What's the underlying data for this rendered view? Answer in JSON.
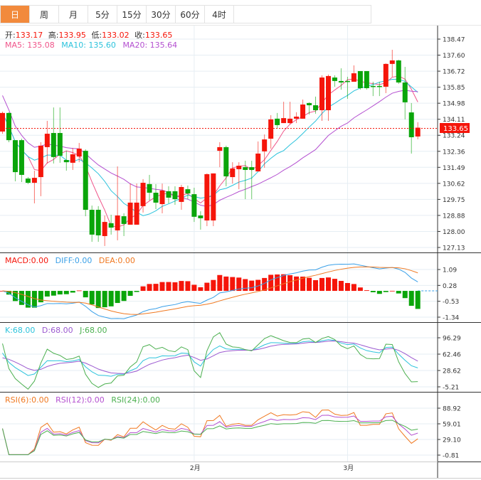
{
  "tabs": [
    {
      "label": "日",
      "active": true
    },
    {
      "label": "周"
    },
    {
      "label": "月"
    },
    {
      "label": "5分"
    },
    {
      "label": "15分"
    },
    {
      "label": "30分"
    },
    {
      "label": "60分"
    },
    {
      "label": "4时"
    }
  ],
  "ohlc_header": {
    "open_label": "开:",
    "open": "133.17",
    "high_label": "高:",
    "high": "133.95",
    "low_label": "低:",
    "low": "133.02",
    "close_label": "收:",
    "close": "133.65"
  },
  "ma_legend": {
    "ma5": "MA5: 135.08",
    "ma10": "MA10: 135.60",
    "ma20": "MA20: 135.64"
  },
  "macd_legend": {
    "macd": "MACD:0.00",
    "diff": "DIFF:0.00",
    "dea": "DEA:0.00"
  },
  "kdj_legend": {
    "k": "K:68.00",
    "d": "D:68.00",
    "j": "J:68.00"
  },
  "rsi_legend": {
    "rsi6": "RSI(6):0.00",
    "rsi12": "RSI(12):0.00",
    "rsi24": "RSI(24):0.00"
  },
  "current_price": "133.65",
  "x_labels": [
    "2月",
    "3月"
  ],
  "colors": {
    "up": "#f5150a",
    "down": "#0aa50a",
    "ma5": "#f0558a",
    "ma10": "#2cc3dc",
    "ma20": "#b450d0",
    "dea": "#f07820",
    "diff": "#3aa0e8",
    "active_tab": "#f28a3c"
  },
  "chart_data": {
    "type": "candlestick",
    "price_axis_ticks": [
      "138.47",
      "137.60",
      "136.72",
      "135.85",
      "134.98",
      "134.11",
      "133.24",
      "132.36",
      "131.49",
      "130.62",
      "129.75",
      "128.88",
      "128.00",
      "127.13"
    ],
    "price_range": [
      127.13,
      138.47
    ],
    "macd_axis_ticks": [
      "1.09",
      "0.28",
      "-0.53",
      "-1.34"
    ],
    "kdj_axis_ticks": [
      "96.29",
      "62.46",
      "28.62",
      "-5.21"
    ],
    "rsi_axis_ticks": [
      "88.92",
      "59.01",
      "29.10",
      "-0.81"
    ],
    "x_label_candle_index": [
      30,
      54
    ],
    "candles": [
      [
        133.44,
        134.52,
        133.32,
        134.45
      ],
      [
        134.45,
        134.49,
        132.86,
        132.97
      ],
      [
        132.97,
        132.97,
        130.73,
        131.23
      ],
      [
        132.97,
        133.05,
        130.69,
        131.08
      ],
      [
        130.88,
        130.96,
        130.58,
        130.65
      ],
      [
        130.65,
        131.31,
        129.53,
        130.92
      ],
      [
        130.96,
        132.86,
        129.92,
        132.67
      ],
      [
        132.59,
        134.02,
        131.7,
        133.32
      ],
      [
        133.36,
        134.75,
        131.7,
        132.05
      ],
      [
        133.36,
        134.75,
        131.74,
        132.12
      ],
      [
        131.89,
        132.39,
        131.31,
        131.77
      ],
      [
        131.74,
        132.55,
        131.35,
        132.2
      ],
      [
        132.08,
        132.82,
        131.77,
        132.51
      ],
      [
        132.39,
        132.47,
        128.83,
        129.18
      ],
      [
        129.18,
        129.41,
        127.44,
        127.83
      ],
      [
        129.18,
        129.38,
        127.44,
        127.79
      ],
      [
        127.75,
        128.87,
        127.21,
        128.52
      ],
      [
        128.45,
        128.91,
        127.83,
        128.21
      ],
      [
        128.06,
        131.54,
        127.52,
        128.87
      ],
      [
        128.83,
        128.99,
        127.75,
        128.41
      ],
      [
        128.37,
        130.61,
        128.37,
        129.57
      ],
      [
        128.37,
        130.61,
        128.37,
        129.57
      ],
      [
        129.38,
        130.85,
        129.03,
        130.65
      ],
      [
        130.58,
        131.08,
        129.69,
        130.11
      ],
      [
        130.11,
        130.58,
        129.22,
        129.57
      ],
      [
        129.49,
        130.61,
        128.99,
        130.23
      ],
      [
        130.19,
        130.46,
        129.53,
        129.84
      ],
      [
        130.19,
        130.46,
        129.45,
        129.76
      ],
      [
        129.61,
        130.54,
        129.18,
        130.42
      ],
      [
        130.3,
        130.5,
        129.76,
        130.07
      ],
      [
        130.03,
        130.38,
        128.52,
        128.8
      ],
      [
        128.87,
        129.1,
        128.1,
        128.72
      ],
      [
        128.6,
        131.16,
        128.29,
        131.12
      ],
      [
        128.6,
        131.16,
        128.29,
        131.16
      ],
      [
        132.39,
        132.86,
        131.5,
        132.59
      ],
      [
        132.59,
        132.67,
        130.46,
        131.0
      ],
      [
        130.96,
        131.77,
        130.61,
        131.43
      ],
      [
        131.39,
        131.77,
        130.3,
        131.58
      ],
      [
        131.5,
        131.85,
        129.76,
        131.35
      ],
      [
        131.5,
        131.85,
        129.76,
        131.35
      ],
      [
        131.27,
        132.9,
        131.27,
        132.24
      ],
      [
        132.36,
        133.28,
        131.47,
        133.01
      ],
      [
        133.05,
        134.33,
        132.51,
        134.1
      ],
      [
        134.14,
        134.45,
        133.59,
        133.79
      ],
      [
        133.9,
        135.06,
        133.9,
        134.17
      ],
      [
        133.9,
        135.06,
        133.83,
        134.14
      ],
      [
        134.14,
        134.49,
        133.9,
        134.25
      ],
      [
        134.14,
        135.18,
        134.14,
        134.91
      ],
      [
        134.99,
        135.03,
        134.37,
        134.87
      ],
      [
        134.87,
        135.34,
        134.41,
        134.6
      ],
      [
        134.6,
        136.5,
        134.02,
        136.38
      ],
      [
        134.6,
        136.54,
        134.02,
        136.46
      ],
      [
        136.38,
        136.5,
        135.88,
        136.19
      ],
      [
        136.19,
        136.88,
        135.72,
        136.11
      ],
      [
        136.19,
        136.42,
        135.22,
        136.15
      ],
      [
        136.15,
        137.04,
        136.15,
        136.61
      ],
      [
        136.73,
        136.73,
        135.72,
        135.8
      ],
      [
        136.73,
        136.73,
        135.72,
        135.8
      ],
      [
        135.92,
        136.15,
        135.37,
        135.88
      ],
      [
        135.92,
        136.15,
        135.37,
        135.88
      ],
      [
        135.88,
        137.15,
        135.53,
        137.12
      ],
      [
        137.12,
        137.89,
        136.42,
        137.31
      ],
      [
        137.31,
        137.35,
        136.03,
        136.11
      ],
      [
        136.11,
        136.96,
        134.1,
        135.03
      ],
      [
        134.48,
        134.99,
        132.24,
        133.13
      ],
      [
        133.17,
        133.95,
        133.02,
        133.65
      ]
    ]
  }
}
